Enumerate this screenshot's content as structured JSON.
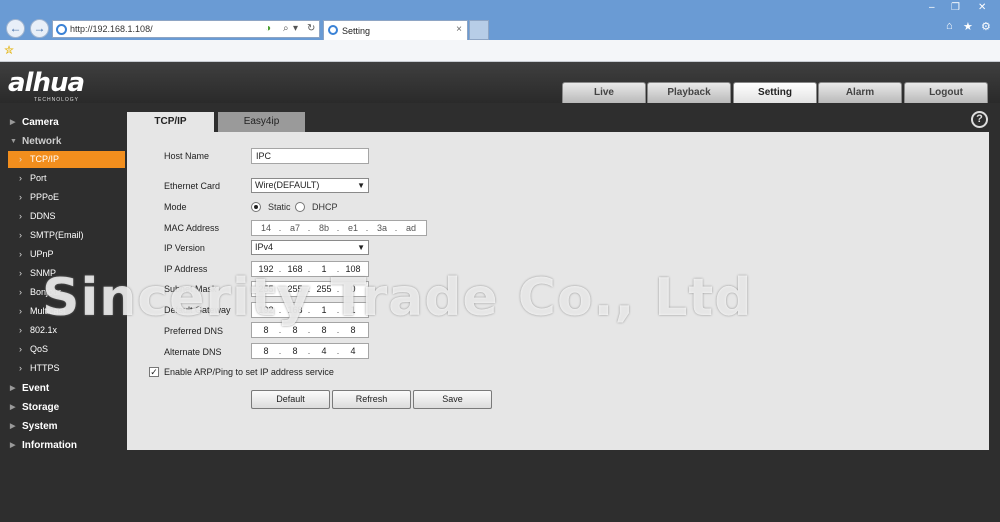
{
  "browser": {
    "url": "http://192.168.1.108/",
    "tab_title": "Setting",
    "tab_close": "×",
    "window_controls": [
      "–",
      "❐",
      "✕"
    ],
    "toolbar_icons": [
      "home-icon",
      "star-icon",
      "gear-icon"
    ],
    "nav_icons": [
      "back-icon",
      "forward-icon"
    ],
    "address_controls": [
      "compat-icon",
      "search-icon",
      "refresh-icon"
    ]
  },
  "app": {
    "logo_text": "alhua",
    "logo_tagline": "TECHNOLOGY",
    "top_nav": [
      {
        "label": "Live"
      },
      {
        "label": "Playback"
      },
      {
        "label": "Setting",
        "active": true
      },
      {
        "label": "Alarm"
      },
      {
        "label": "Logout"
      }
    ]
  },
  "sidebar": {
    "groups_top": [
      {
        "label": "Camera"
      },
      {
        "label": "Network"
      }
    ],
    "network_items": [
      {
        "label": "TCP/IP",
        "active": true
      },
      {
        "label": "Port"
      },
      {
        "label": "PPPoE"
      },
      {
        "label": "DDNS"
      },
      {
        "label": "SMTP(Email)"
      },
      {
        "label": "UPnP"
      },
      {
        "label": "SNMP"
      },
      {
        "label": "Bonjour"
      },
      {
        "label": "Multicast"
      },
      {
        "label": "802.1x"
      },
      {
        "label": "QoS"
      },
      {
        "label": "HTTPS"
      }
    ],
    "groups_bottom": [
      {
        "label": "Event"
      },
      {
        "label": "Storage"
      },
      {
        "label": "System"
      },
      {
        "label": "Information"
      }
    ]
  },
  "content": {
    "tabs": [
      {
        "label": "TCP/IP",
        "active": true
      },
      {
        "label": "Easy4ip"
      }
    ],
    "help": "?",
    "form": {
      "host_name": {
        "label": "Host Name",
        "value": "IPC"
      },
      "ethernet_card": {
        "label": "Ethernet Card",
        "value": "Wire(DEFAULT)"
      },
      "mode": {
        "label": "Mode",
        "options": [
          "Static",
          "DHCP"
        ],
        "selected": "Static"
      },
      "mac_address": {
        "label": "MAC Address",
        "value": [
          "14",
          "a7",
          "8b",
          "e1",
          "3a",
          "ad"
        ]
      },
      "ip_version": {
        "label": "IP Version",
        "value": "IPv4"
      },
      "ip_address": {
        "label": "IP Address",
        "value": [
          "192",
          "168",
          "1",
          "108"
        ]
      },
      "subnet_mask": {
        "label": "Subnet Mask",
        "value": [
          "255",
          "255",
          "255",
          "0"
        ]
      },
      "default_gateway": {
        "label": "Default Gateway",
        "value": [
          "192",
          "168",
          "1",
          "1"
        ]
      },
      "preferred_dns": {
        "label": "Preferred DNS",
        "value": [
          "8",
          "8",
          "8",
          "8"
        ]
      },
      "alternate_dns": {
        "label": "Alternate DNS",
        "value": [
          "8",
          "8",
          "4",
          "4"
        ]
      },
      "arp_ping": {
        "label": "Enable ARP/Ping to set IP address service",
        "checked": true
      }
    },
    "buttons": {
      "default": "Default",
      "refresh": "Refresh",
      "save": "Save"
    }
  },
  "watermark": "Sincerity Trade Co., Ltd"
}
